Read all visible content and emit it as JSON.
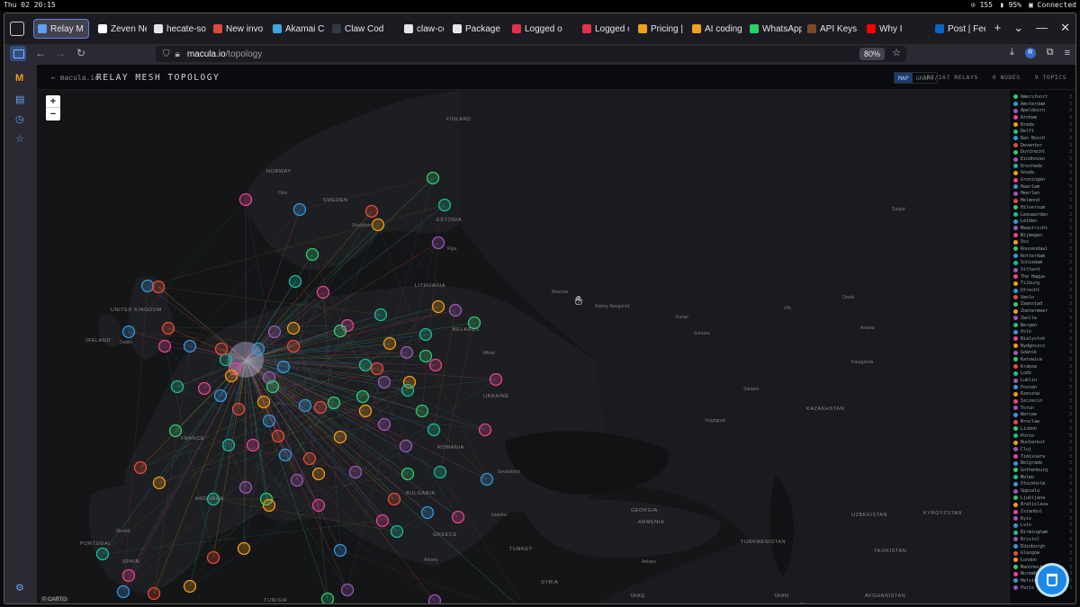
{
  "system": {
    "clock": "Thu 02 20:15",
    "cpu": "155",
    "battery": "95%",
    "connection": "Connected"
  },
  "tabs": [
    {
      "label": "Relay M",
      "color": "#5aa0ff",
      "active": true
    },
    {
      "label": "Zeven Ne",
      "color": "#ffffff"
    },
    {
      "label": "hecate-so",
      "color": "#e6e6e6"
    },
    {
      "label": "New invo",
      "color": "#e04a3b"
    },
    {
      "label": "Akamai C",
      "color": "#3aa7e0"
    },
    {
      "label": "Claw Cod",
      "color": "#333a44"
    },
    {
      "label": "claw-code",
      "color": "#e6e6e6"
    },
    {
      "label": "Package",
      "color": "#e6e6e6"
    },
    {
      "label": "Logged o",
      "color": "#e0324a"
    },
    {
      "label": "Logged o",
      "color": "#e0324a"
    },
    {
      "label": "Pricing | I",
      "color": "#f0a020"
    },
    {
      "label": "AI coding",
      "color": "#f0a020"
    },
    {
      "label": "WhatsApp",
      "color": "#25d366"
    },
    {
      "label": "API Keys",
      "color": "#7a4a2a"
    },
    {
      "label": "Why I",
      "color": "#ff0000"
    },
    {
      "label": "Post | Fee",
      "color": "#0a66c2"
    }
  ],
  "url": {
    "host": "macula.io",
    "path": "/topology",
    "zoom": "80%"
  },
  "header": {
    "back_label": "← macula.io",
    "title": "RELAY MESH TOPOLOGY",
    "view_map": "MAP",
    "view_graph": "GRAPH",
    "relays": "167/167 RELAYS",
    "nodes": "0 NODES",
    "topics": "9 TOPICS"
  },
  "map": {
    "zoom_in": "+",
    "zoom_out": "−",
    "attribution": "© CARTO",
    "labels": [
      {
        "text": "FINLAND",
        "type": "country"
      },
      {
        "text": "NORWAY",
        "type": "country"
      },
      {
        "text": "SWEDEN",
        "type": "country"
      },
      {
        "text": "ESTONIA",
        "type": "country"
      },
      {
        "text": "LITHUANIA",
        "type": "country"
      },
      {
        "text": "BELARUS",
        "type": "country"
      },
      {
        "text": "UNITED KINGDOM",
        "type": "country"
      },
      {
        "text": "IRELAND",
        "type": "country"
      },
      {
        "text": "UKRAINE",
        "type": "country"
      },
      {
        "text": "FRANCE",
        "type": "country"
      },
      {
        "text": "ROMANIA",
        "type": "country"
      },
      {
        "text": "BULGARIA",
        "type": "country"
      },
      {
        "text": "SPAIN",
        "type": "country"
      },
      {
        "text": "PORTUGAL",
        "type": "country"
      },
      {
        "text": "GREECE",
        "type": "country"
      },
      {
        "text": "TURKEY",
        "type": "country"
      },
      {
        "text": "GEORGIA",
        "type": "country"
      },
      {
        "text": "ARMENIA",
        "type": "country"
      },
      {
        "text": "KAZAKHSTAN",
        "type": "country"
      },
      {
        "text": "UZBEKISTAN",
        "type": "country"
      },
      {
        "text": "KYRGYZSTAN",
        "type": "country"
      },
      {
        "text": "TURKMENISTAN",
        "type": "country"
      },
      {
        "text": "TAJIKISTAN",
        "type": "country"
      },
      {
        "text": "AFGHANISTAN",
        "type": "country"
      },
      {
        "text": "IRAN",
        "type": "country"
      },
      {
        "text": "IRAQ",
        "type": "country"
      },
      {
        "text": "SYRIA",
        "type": "country"
      },
      {
        "text": "TUNISIA",
        "type": "country"
      },
      {
        "text": "ANDORRA",
        "type": "country"
      },
      {
        "text": "Moscow",
        "type": "city"
      },
      {
        "text": "Nizhny Novgorod",
        "type": "city"
      },
      {
        "text": "Kazan",
        "type": "city"
      },
      {
        "text": "Ufa",
        "type": "city"
      },
      {
        "text": "Samara",
        "type": "city"
      },
      {
        "text": "Saratov",
        "type": "city"
      },
      {
        "text": "Volgograd",
        "type": "city"
      },
      {
        "text": "Surgut",
        "type": "city"
      },
      {
        "text": "Omsk",
        "type": "city"
      },
      {
        "text": "Karaganda",
        "type": "city"
      },
      {
        "text": "Astana",
        "type": "city"
      },
      {
        "text": "Tehran",
        "type": "city"
      },
      {
        "text": "Madrid",
        "type": "city"
      },
      {
        "text": "Sevastopol",
        "type": "city"
      },
      {
        "text": "Minsk",
        "type": "city"
      },
      {
        "text": "Istanbul",
        "type": "city"
      },
      {
        "text": "Ankara",
        "type": "city"
      },
      {
        "text": "Athens",
        "type": "city"
      },
      {
        "text": "Oslo",
        "type": "city"
      },
      {
        "text": "Stockholm",
        "type": "city"
      },
      {
        "text": "Riga",
        "type": "city"
      },
      {
        "text": "Dublin",
        "type": "city"
      },
      {
        "text": "Mediterranean Sea",
        "type": "city"
      }
    ]
  },
  "legend": [
    {
      "name": "Amersfoort",
      "color": "#2ecc71",
      "count": "3"
    },
    {
      "name": "Amsterdam",
      "color": "#3498db",
      "count": "3"
    },
    {
      "name": "Apeldoorn",
      "color": "#9b59b6",
      "count": "3"
    },
    {
      "name": "Arnhem",
      "color": "#e84393",
      "count": "3"
    },
    {
      "name": "Breda",
      "color": "#f39c12",
      "count": "3"
    },
    {
      "name": "Delft",
      "color": "#1abc9c",
      "count": "3"
    },
    {
      "name": "Den Bosch",
      "color": "#3498db",
      "count": "3"
    },
    {
      "name": "Deventer",
      "color": "#e74c3c",
      "count": "3"
    },
    {
      "name": "Dordrecht",
      "color": "#2ecc71",
      "count": "3"
    },
    {
      "name": "Eindhoven",
      "color": "#9b59b6",
      "count": "3"
    },
    {
      "name": "Enschede",
      "color": "#1abc9c",
      "count": "3"
    },
    {
      "name": "Gouda",
      "color": "#f39c12",
      "count": "3"
    },
    {
      "name": "Groningen",
      "color": "#e84393",
      "count": "3"
    },
    {
      "name": "Haarlem",
      "color": "#3498db",
      "count": "3"
    },
    {
      "name": "Heerlen",
      "color": "#9b59b6",
      "count": "3"
    },
    {
      "name": "Helmond",
      "color": "#e74c3c",
      "count": "3"
    },
    {
      "name": "Hilversum",
      "color": "#2ecc71",
      "count": "3"
    },
    {
      "name": "Leeuwarden",
      "color": "#1abc9c",
      "count": "3"
    },
    {
      "name": "Leiden",
      "color": "#3498db",
      "count": "3"
    },
    {
      "name": "Maastricht",
      "color": "#9b59b6",
      "count": "3"
    },
    {
      "name": "Nijmegen",
      "color": "#e84393",
      "count": "3"
    },
    {
      "name": "Oss",
      "color": "#f39c12",
      "count": "3"
    },
    {
      "name": "Roosendaal",
      "color": "#2ecc71",
      "count": "3"
    },
    {
      "name": "Rotterdam",
      "color": "#3498db",
      "count": "3"
    },
    {
      "name": "Schiedam",
      "color": "#1abc9c",
      "count": "3"
    },
    {
      "name": "Sittard",
      "color": "#9b59b6",
      "count": "3"
    },
    {
      "name": "The Hague",
      "color": "#e84393",
      "count": "3"
    },
    {
      "name": "Tilburg",
      "color": "#f39c12",
      "count": "3"
    },
    {
      "name": "Utrecht",
      "color": "#3498db",
      "count": "3"
    },
    {
      "name": "Venlo",
      "color": "#e74c3c",
      "count": "3"
    },
    {
      "name": "Zaanstad",
      "color": "#2ecc71",
      "count": "3"
    },
    {
      "name": "Zoetermeer",
      "color": "#f39c12",
      "count": "3"
    },
    {
      "name": "Zwolle",
      "color": "#9b59b6",
      "count": "3"
    },
    {
      "name": "Bergen",
      "color": "#1abc9c",
      "count": "3"
    },
    {
      "name": "Oslo",
      "color": "#3498db",
      "count": "3"
    },
    {
      "name": "Bialystok",
      "color": "#e84393",
      "count": "3"
    },
    {
      "name": "Bydgoszcz",
      "color": "#f39c12",
      "count": "3"
    },
    {
      "name": "Gdansk",
      "color": "#9b59b6",
      "count": "3"
    },
    {
      "name": "Katowice",
      "color": "#2ecc71",
      "count": "3"
    },
    {
      "name": "Krakow",
      "color": "#e74c3c",
      "count": "3"
    },
    {
      "name": "Lodz",
      "color": "#1abc9c",
      "count": "3"
    },
    {
      "name": "Lublin",
      "color": "#9b59b6",
      "count": "3"
    },
    {
      "name": "Poznan",
      "color": "#3498db",
      "count": "3"
    },
    {
      "name": "Rzeszow",
      "color": "#f39c12",
      "count": "3"
    },
    {
      "name": "Szczecin",
      "color": "#e84393",
      "count": "3"
    },
    {
      "name": "Torun",
      "color": "#9b59b6",
      "count": "3"
    },
    {
      "name": "Warsaw",
      "color": "#3498db",
      "count": "3"
    },
    {
      "name": "Wroclaw",
      "color": "#e74c3c",
      "count": "3"
    },
    {
      "name": "Lisbon",
      "color": "#2ecc71",
      "count": "3"
    },
    {
      "name": "Porto",
      "color": "#1abc9c",
      "count": "3"
    },
    {
      "name": "Bucharest",
      "color": "#f39c12",
      "count": "3"
    },
    {
      "name": "Cluj",
      "color": "#9b59b6",
      "count": "3"
    },
    {
      "name": "Timisoara",
      "color": "#e84393",
      "count": "3"
    },
    {
      "name": "Belgrade",
      "color": "#3498db",
      "count": "3"
    },
    {
      "name": "Gothenburg",
      "color": "#2ecc71",
      "count": "3"
    },
    {
      "name": "Malmo",
      "color": "#1abc9c",
      "count": "3"
    },
    {
      "name": "Stockholm",
      "color": "#3498db",
      "count": "3"
    },
    {
      "name": "Uppsala",
      "color": "#9b59b6",
      "count": "3"
    },
    {
      "name": "Ljubljana",
      "color": "#2ecc71",
      "count": "3"
    },
    {
      "name": "Bratislava",
      "color": "#f39c12",
      "count": "3"
    },
    {
      "name": "Istanbul",
      "color": "#e84393",
      "count": "3"
    },
    {
      "name": "Kyiv",
      "color": "#9b59b6",
      "count": "3"
    },
    {
      "name": "Lviv",
      "color": "#3498db",
      "count": "3"
    },
    {
      "name": "Birmingham",
      "color": "#1abc9c",
      "count": "3"
    },
    {
      "name": "Bristol",
      "color": "#9b59b6",
      "count": "3"
    },
    {
      "name": "Edinburgh",
      "color": "#3498db",
      "count": "3"
    },
    {
      "name": "Glasgow",
      "color": "#e74c3c",
      "count": "3"
    },
    {
      "name": "London",
      "color": "#f39c12",
      "count": "3"
    },
    {
      "name": "Manchester",
      "color": "#2ecc71",
      "count": "3"
    },
    {
      "name": "Nuremberg",
      "color": "#e84393",
      "count": "3"
    },
    {
      "name": "Helsinki",
      "color": "#3498db",
      "count": "3"
    },
    {
      "name": "Paris",
      "color": "#9b59b6",
      "count": "3"
    }
  ],
  "palette": [
    "#2ecc71",
    "#3498db",
    "#9b59b6",
    "#e84393",
    "#f39c12",
    "#1abc9c",
    "#e74c3c"
  ]
}
